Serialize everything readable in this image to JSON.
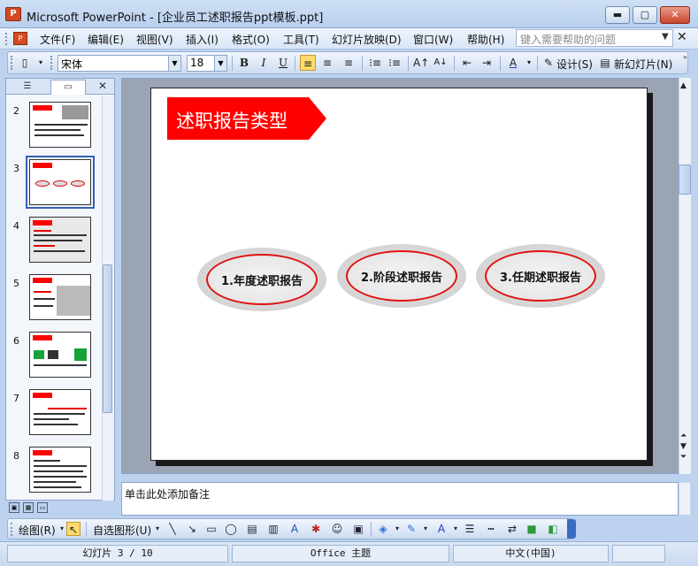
{
  "window": {
    "title": "Microsoft PowerPoint - [企业员工述职报告ppt模板.ppt]",
    "app_icon": "powerpoint-icon",
    "controls": {
      "minimize": "▬",
      "maximize": "▢",
      "close": "✕"
    }
  },
  "menubar": {
    "items": [
      "文件(F)",
      "编辑(E)",
      "视图(V)",
      "插入(I)",
      "格式(O)",
      "工具(T)",
      "幻灯片放映(D)",
      "窗口(W)",
      "帮助(H)"
    ],
    "help_placeholder": "键入需要帮助的问题",
    "close": "✕"
  },
  "toolbar": {
    "font": "宋体",
    "size": "18",
    "bold": "B",
    "italic": "I",
    "underline": "U",
    "design_label": "设计(S)",
    "new_slide_label": "新幻灯片(N)"
  },
  "pane": {
    "tabs": [
      "outline-tab",
      "slides-tab"
    ],
    "close": "✕",
    "slide_numbers": [
      "2",
      "3",
      "4",
      "5",
      "6",
      "7",
      "8"
    ],
    "selected": "3"
  },
  "slide": {
    "title": "述职报告类型",
    "items": [
      "1.年度述职报告",
      "2.阶段述职报告",
      "3.任期述职报告"
    ],
    "colors": {
      "banner": "#ff0000",
      "oval_border": "#e01212"
    }
  },
  "notes": {
    "placeholder": "单击此处添加备注"
  },
  "drawbar": {
    "draw_label": "绘图(R)",
    "autoshapes_label": "自选图形(U)"
  },
  "status": {
    "slide": "幻灯片 3 / 10",
    "theme": "Office 主题",
    "language": "中文(中国)"
  }
}
